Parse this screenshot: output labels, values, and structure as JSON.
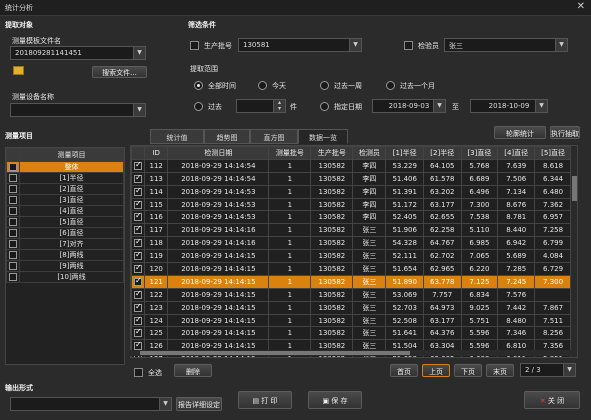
{
  "window": {
    "title": "统计分析",
    "close": "✕"
  },
  "target": {
    "section": "提取对象",
    "template_label": "测量模板文件名",
    "template_value": "201809281141451",
    "browse_btn": "搜索文件...",
    "device_label": "测量设备名称",
    "device_value": ""
  },
  "filter": {
    "section": "筛选条件",
    "batch_label": "生产批号",
    "batch_value": "130581",
    "inspector_label": "检验员",
    "inspector_value": "张三",
    "range_label": "提取范围",
    "all_time": "全部时间",
    "today": "今天",
    "last_week": "过去一周",
    "last_month": "过去一个月",
    "past": "过去",
    "unit": "件",
    "spec_date": "指定日期",
    "date_from": "2018-09-03",
    "date_to_sep": "至",
    "date_to": "2018-10-09"
  },
  "items": {
    "section": "测量项目",
    "header": "测量项目",
    "list": [
      "整体",
      "[1]半径",
      "[2]直径",
      "[3]直径",
      "[4]直径",
      "[5]直径",
      "[6]直径",
      "[7]对齐",
      "[8]两线",
      "[9]两线",
      "[10]两线"
    ]
  },
  "tabs": [
    "统计值",
    "趋势图",
    "直方图",
    "数据一览"
  ],
  "actions": {
    "rotate": "轮廓统计",
    "extract": "执行抽取"
  },
  "table": {
    "headers": [
      "ID",
      "检测日期",
      "测量批号",
      "生产批号",
      "检测员",
      "[1]半径",
      "[2]半径",
      "[3]直径",
      "[4]直径",
      "[5]直径"
    ],
    "rows": [
      [
        "112",
        "2018-09-29 14:14:54",
        "1",
        "130582",
        "李四",
        "53.229",
        "64.105",
        "5.768",
        "7.639",
        "8.618"
      ],
      [
        "113",
        "2018-09-29 14:14:54",
        "1",
        "130582",
        "李四",
        "51.406",
        "61.578",
        "6.689",
        "7.506",
        "6.344"
      ],
      [
        "114",
        "2018-09-29 14:14:53",
        "1",
        "130582",
        "李四",
        "51.391",
        "63.202",
        "6.496",
        "7.134",
        "6.480"
      ],
      [
        "115",
        "2018-09-29 14:14:53",
        "1",
        "130582",
        "李四",
        "51.172",
        "63.177",
        "7.300",
        "8.676",
        "7.362"
      ],
      [
        "116",
        "2018-09-29 14:14:53",
        "1",
        "130582",
        "李四",
        "52.405",
        "62.655",
        "7.538",
        "8.781",
        "6.957"
      ],
      [
        "117",
        "2018-09-29 14:14:16",
        "1",
        "130582",
        "张三",
        "51.906",
        "62.258",
        "5.110",
        "8.440",
        "7.258"
      ],
      [
        "118",
        "2018-09-29 14:14:16",
        "1",
        "130582",
        "张三",
        "54.328",
        "64.767",
        "6.985",
        "6.942",
        "6.799"
      ],
      [
        "119",
        "2018-09-29 14:14:15",
        "1",
        "130582",
        "张三",
        "52.111",
        "62.702",
        "7.065",
        "5.689",
        "4.084"
      ],
      [
        "120",
        "2018-09-29 14:14:15",
        "1",
        "130582",
        "张三",
        "51.654",
        "62.965",
        "6.220",
        "7.285",
        "6.729"
      ],
      [
        "121",
        "2018-09-29 14:14:15",
        "1",
        "130582",
        "张三",
        "51.890",
        "63.778",
        "7.125",
        "7.245",
        "7.300"
      ],
      [
        "122",
        "2018-09-29 14:14:15",
        "1",
        "130582",
        "张三",
        "53.069",
        "7.757",
        "6.834",
        "7.576"
      ],
      [
        "123",
        "2018-09-29 14:14:15",
        "1",
        "130582",
        "张三",
        "52.703",
        "64.973",
        "9.025",
        "7.442",
        "7.867"
      ],
      [
        "124",
        "2018-09-29 14:14:15",
        "1",
        "130582",
        "张三",
        "52.508",
        "63.177",
        "5.751",
        "8.480",
        "7.511"
      ],
      [
        "125",
        "2018-09-29 14:14:15",
        "1",
        "130582",
        "张三",
        "51.641",
        "64.376",
        "5.596",
        "7.346",
        "8.256"
      ],
      [
        "126",
        "2018-09-29 14:14:15",
        "1",
        "130582",
        "张三",
        "51.504",
        "63.304",
        "5.596",
        "6.810",
        "7.356"
      ],
      [
        "127",
        "2018-09-29 14:14:15",
        "1",
        "130582",
        "张三",
        "51.658",
        "63.605",
        "6.683",
        "6.811",
        "5.851"
      ]
    ],
    "selected_id": "121"
  },
  "footer": {
    "select_all": "全选",
    "delete": "删除",
    "first": "首页",
    "prev": "上页",
    "next": "下页",
    "last": "末页",
    "page": "2 / 3",
    "output_section": "输出形式",
    "report_detail": "报告详细设定",
    "print": "打 印",
    "save": "保 存",
    "close": "关 闭"
  },
  "colors": {
    "accent": "#d9820f",
    "bg": "#2b2b2b"
  }
}
